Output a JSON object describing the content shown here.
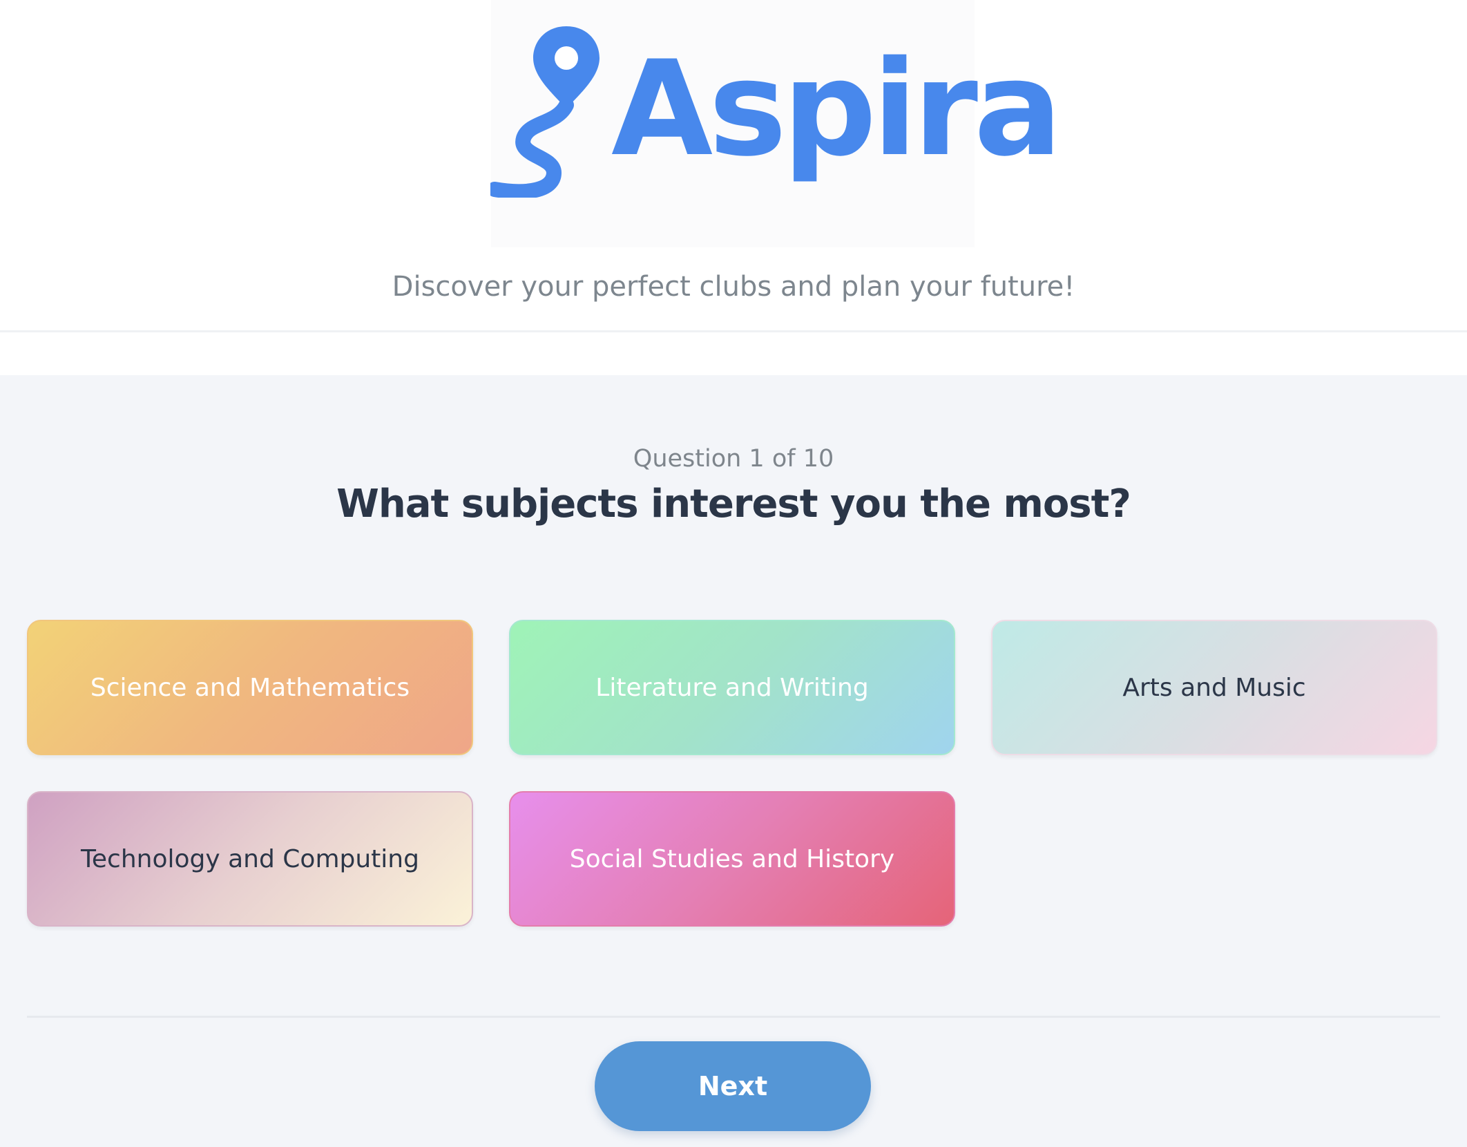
{
  "brand": {
    "name": "Aspira",
    "tagline": "Discover your perfect clubs and plan your future!",
    "color": "#4888ec"
  },
  "quiz": {
    "counter": "Question 1 of 10",
    "question": "What subjects interest you the most?",
    "options": [
      {
        "label": "Science and Mathematics"
      },
      {
        "label": "Literature and Writing"
      },
      {
        "label": "Arts and Music"
      },
      {
        "label": "Technology and Computing"
      },
      {
        "label": "Social Studies and History"
      }
    ],
    "next_label": "Next"
  },
  "icons": {
    "logo": "map-pin-path-icon"
  },
  "colors": {
    "primary_button": "#5596d6",
    "heading": "#2b3648",
    "muted_text": "#7d868e",
    "section_background": "#f3f5f9"
  }
}
